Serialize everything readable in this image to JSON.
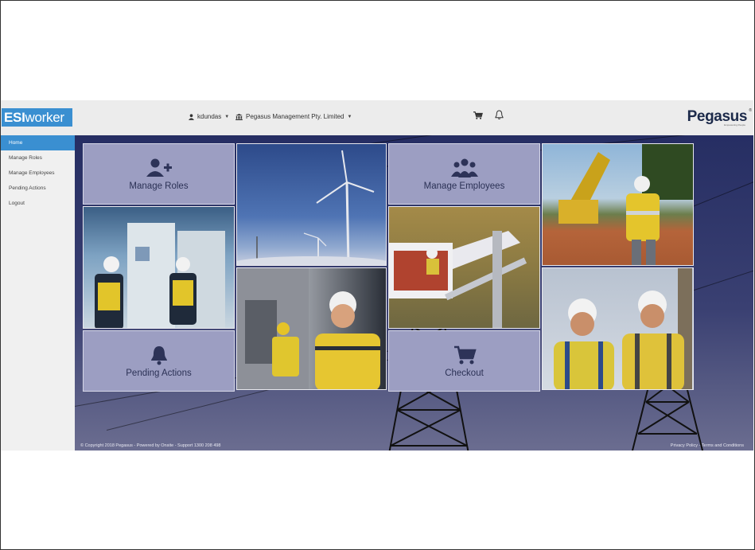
{
  "header": {
    "logo_bold": "ESI",
    "logo_rest": "worker",
    "user_name": "kdundas",
    "company_name": "Pegasus Management Pty. Limited",
    "brand_name": "Pegasus",
    "brand_tagline": "Empowering People"
  },
  "sidebar": {
    "items": [
      {
        "label": "Home",
        "active": true
      },
      {
        "label": "Manage Roles",
        "active": false
      },
      {
        "label": "Manage Employees",
        "active": false
      },
      {
        "label": "Pending Actions",
        "active": false
      },
      {
        "label": "Logout",
        "active": false
      }
    ]
  },
  "tiles": {
    "manage_roles": {
      "label": "Manage Roles",
      "icon": "user-plus-icon"
    },
    "manage_employees": {
      "label": "Manage Employees",
      "icon": "users-group-icon"
    },
    "pending_actions": {
      "label": "Pending Actions",
      "icon": "bell-icon"
    },
    "checkout": {
      "label": "Checkout",
      "icon": "cart-icon"
    }
  },
  "footer": {
    "copyright": "© Copyright 2018 Pegasus - Powered by Onsite - Support 1300 208 498",
    "links": "Privacy Policy - Terms and Conditions"
  },
  "colors": {
    "accent": "#3a8fd1",
    "tile_bg": "#9c9ec2",
    "background": "#2b3266"
  }
}
